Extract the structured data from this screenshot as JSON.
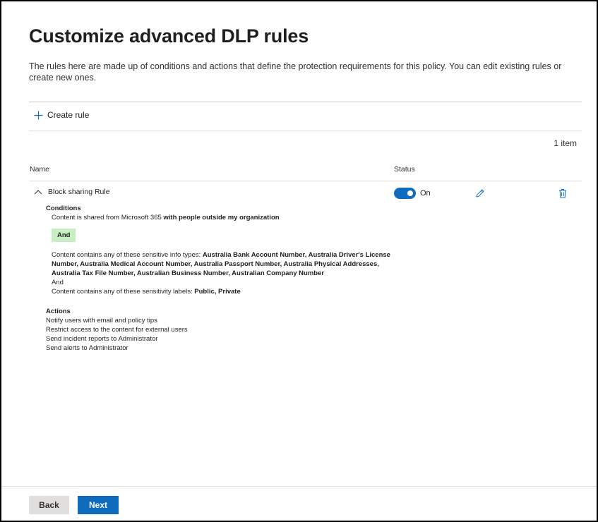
{
  "page": {
    "title": "Customize advanced DLP rules",
    "description": "The rules here are made up of conditions and actions that define the protection requirements for this policy. You can edit existing rules or create new ones."
  },
  "toolbar": {
    "create_rule_label": "Create rule",
    "item_count": "1 item"
  },
  "table": {
    "columns": {
      "name": "Name",
      "status": "Status"
    },
    "rows": [
      {
        "name": "Block sharing Rule",
        "status_label": "On",
        "status_on": true,
        "conditions_title": "Conditions",
        "condition_1_prefix": "Content is shared from Microsoft 365 ",
        "condition_1_bold": "with people outside my organization",
        "and_badge": "And",
        "condition_2_prefix": "Content contains any of these sensitive info types: ",
        "condition_2_bold": "Australia Bank Account Number, Australia Driver's License Number, Australia Medical Account Number, Australia Passport Number, Australia Physical Addresses, Australia Tax File Number, Australian Business Number, Australian Company Number",
        "and_text": "And",
        "condition_3_prefix": "Content contains any of these sensitivity labels: ",
        "condition_3_bold": "Public, Private",
        "actions_title": "Actions",
        "actions": [
          "Notify users with email and policy tips",
          "Restrict access to the content for external users",
          "Send incident reports to Administrator",
          "Send alerts to Administrator"
        ]
      }
    ]
  },
  "footer": {
    "back_label": "Back",
    "next_label": "Next"
  },
  "colors": {
    "accent": "#0f6cbd",
    "and_badge_bg": "#c7efc3"
  }
}
